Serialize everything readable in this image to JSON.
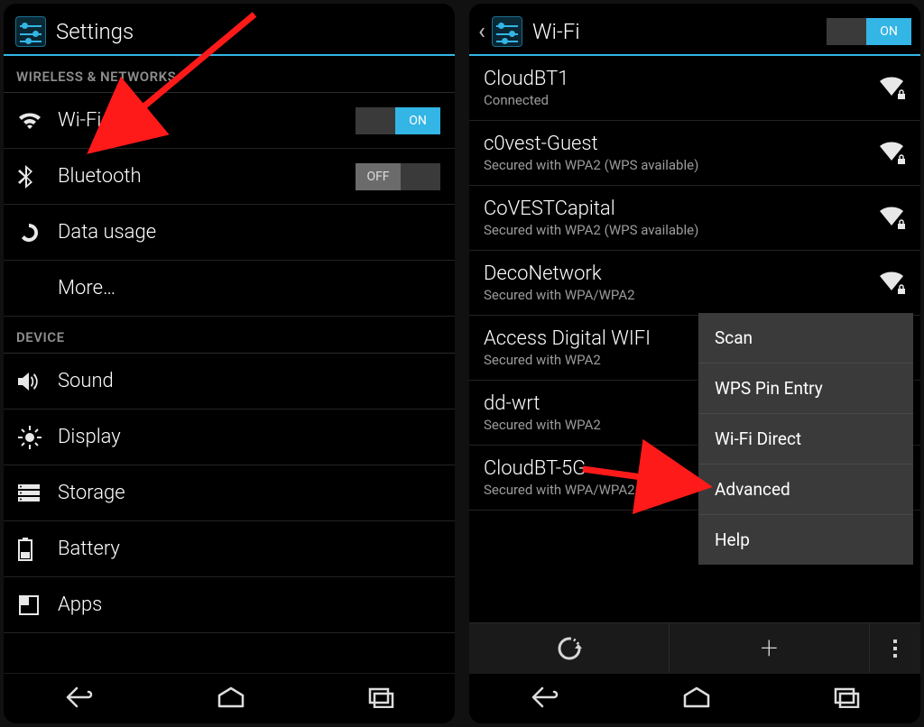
{
  "left": {
    "title": "Settings",
    "sections": {
      "wireless_header": "WIRELESS & NETWORKS",
      "device_header": "DEVICE"
    },
    "items": {
      "wifi": {
        "label": "Wi-Fi",
        "toggle": "ON"
      },
      "bluetooth": {
        "label": "Bluetooth",
        "toggle": "OFF"
      },
      "data_usage": {
        "label": "Data usage"
      },
      "more": {
        "label": "More…"
      },
      "sound": {
        "label": "Sound"
      },
      "display": {
        "label": "Display"
      },
      "storage": {
        "label": "Storage"
      },
      "battery": {
        "label": "Battery"
      },
      "apps": {
        "label": "Apps"
      }
    }
  },
  "right": {
    "title": "Wi-Fi",
    "toggle": "ON",
    "networks": [
      {
        "name": "CloudBT1",
        "status": "Connected",
        "secured": true
      },
      {
        "name": "c0vest-Guest",
        "status": "Secured with WPA2 (WPS available)",
        "secured": true
      },
      {
        "name": "CoVESTCapital",
        "status": "Secured with WPA2 (WPS available)",
        "secured": true
      },
      {
        "name": "DecoNetwork",
        "status": "Secured with WPA/WPA2",
        "secured": true
      },
      {
        "name": "Access Digital WIFI",
        "status": "Secured with WPA2",
        "secured": true
      },
      {
        "name": "dd-wrt",
        "status": "Secured with WPA2",
        "secured": true
      },
      {
        "name": "CloudBT-5G",
        "status": "Secured with WPA/WPA2",
        "secured": true
      }
    ],
    "menu": {
      "scan": "Scan",
      "wps": "WPS Pin Entry",
      "direct": "Wi-Fi Direct",
      "advanced": "Advanced",
      "help": "Help"
    }
  },
  "colors": {
    "accent": "#33b5e5"
  }
}
